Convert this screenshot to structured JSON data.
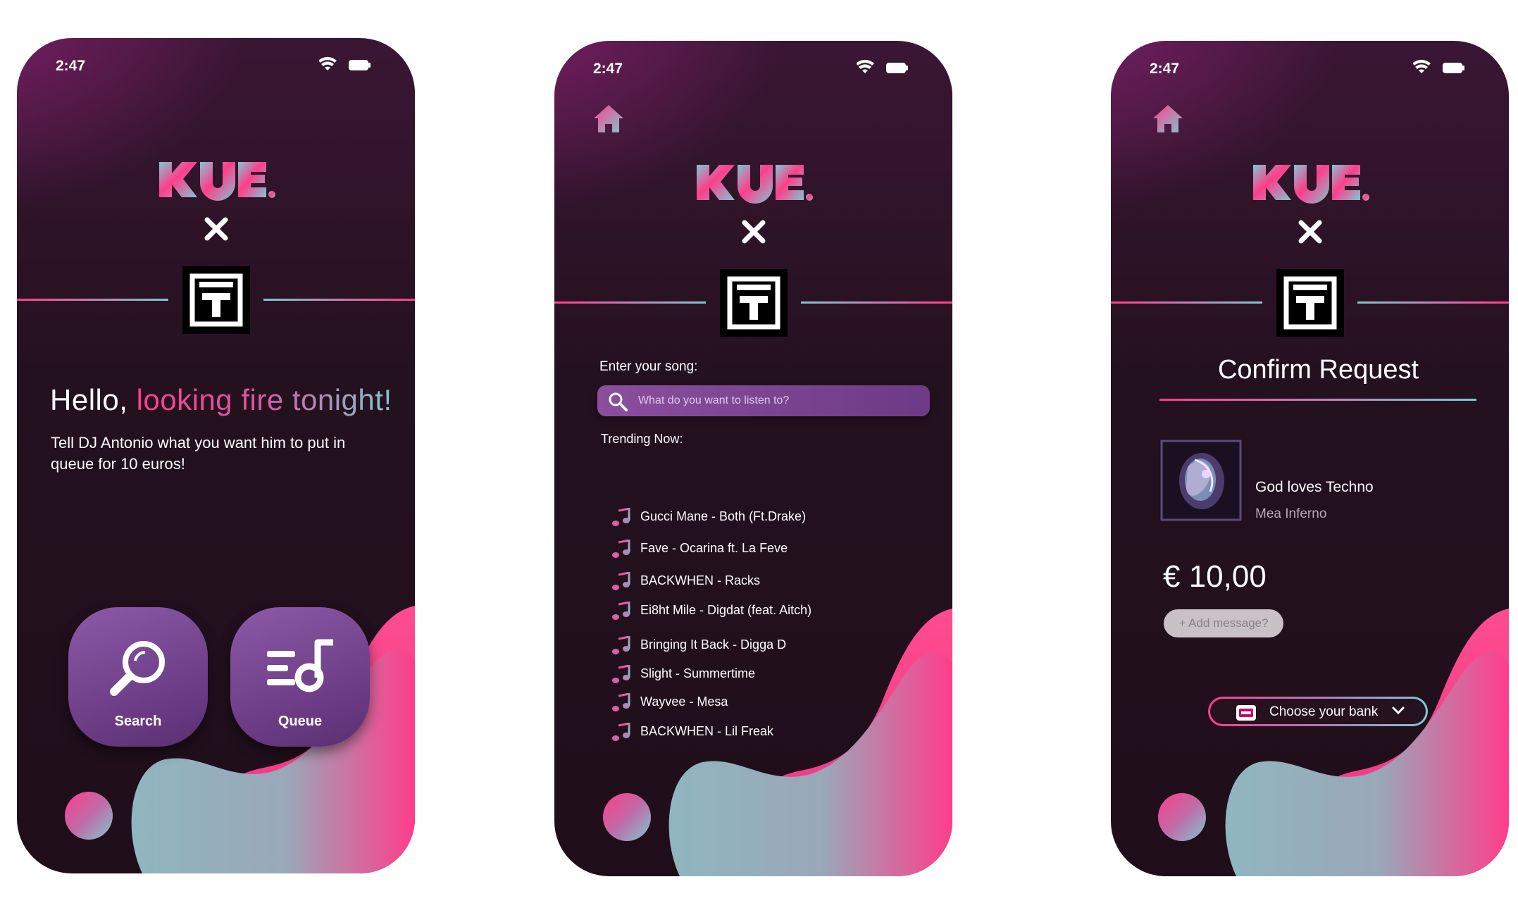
{
  "status_bar": {
    "time": "2:47"
  },
  "brand": {
    "name": "KUE."
  },
  "colors": {
    "accent_pink": "#ff3d8b",
    "accent_teal": "#7fc7cf",
    "button_purple": "#7a4896",
    "background": "#24111f"
  },
  "home_screen": {
    "greeting_prefix": "Hello, ",
    "greeting_accent": "looking fire tonight!",
    "description": "Tell DJ Antonio what you want him to put in queue for 10 euros!",
    "buttons": [
      {
        "label": "Search",
        "icon": "magnifier-icon"
      },
      {
        "label": "Queue",
        "icon": "queue-music-icon"
      }
    ]
  },
  "search_screen": {
    "enter_label": "Enter your song:",
    "search_placeholder": "What do you want to listen to?",
    "trending_label": "Trending Now:",
    "songs": [
      "Gucci Mane - Both (Ft.Drake)",
      "Fave - Ocarina ft. La Feve",
      "BACKWHEN - Racks",
      "Ei8ht Mile - Digdat (feat. Aitch)",
      "Bringing It Back - Digga D",
      "Slight - Summertime",
      "Wayvee - Mesa",
      "BACKWHEN - Lil Freak"
    ]
  },
  "confirm_screen": {
    "title": "Confirm Request",
    "song_title": "God loves Techno",
    "artist": "Mea Inferno",
    "price": "€ 10,00",
    "add_message": "+ Add message?",
    "bank_button": "Choose your bank"
  }
}
